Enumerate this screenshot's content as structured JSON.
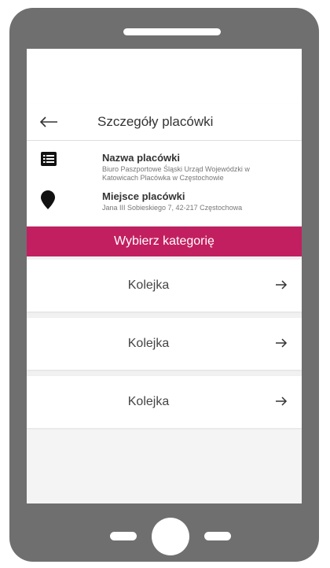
{
  "header": {
    "title": "Szczegóły placówki"
  },
  "details": {
    "name_label": "Nazwa placówki",
    "name_value": "Biuro Paszportowe Śląski Urząd Wojewódzki w Katowicach Placówka w Częstochowie",
    "place_label": "Miejsce placówki",
    "place_value": "Jana III Sobieskiego 7, 42-217 Częstochowa",
    "icons": [
      "list-icon",
      "location-pin-icon"
    ]
  },
  "banner": {
    "text": "Wybierz kategorię",
    "color": "#c21f60"
  },
  "list": {
    "items": [
      {
        "label": "Kolejka"
      },
      {
        "label": "Kolejka"
      },
      {
        "label": "Kolejka"
      }
    ]
  },
  "colors": {
    "phone_frame": "#6f6f6f",
    "accent": "#c21f60"
  }
}
